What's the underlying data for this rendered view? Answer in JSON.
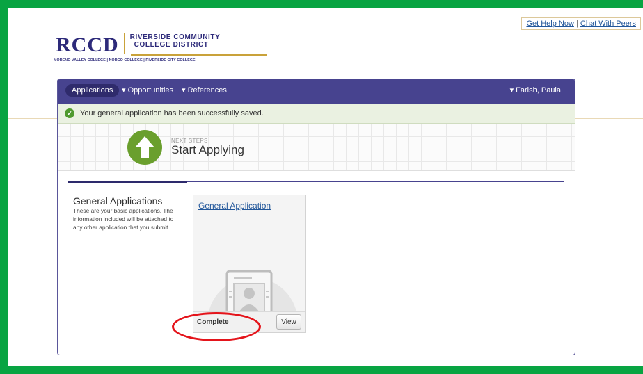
{
  "help": {
    "get_help": "Get Help Now",
    "separator": "|",
    "chat": "Chat With Peers"
  },
  "logo": {
    "acronym": "RCCD",
    "name_line1": "RIVERSIDE COMMUNITY",
    "name_line2": "COLLEGE DISTRICT",
    "colleges": "MORENO VALLEY COLLEGE | NORCO COLLEGE | RIVERSIDE CITY COLLEGE"
  },
  "nav": {
    "applications": "Applications",
    "opportunities": "▾ Opportunities",
    "references": "▾ References",
    "user": "▾ Farish, Paula"
  },
  "alert": {
    "icon": "check-circle-icon",
    "message": "Your general application has been successfully saved."
  },
  "banner": {
    "icon": "arrow-up-icon",
    "next_label": "NEXT STEPS",
    "title": "Start Applying"
  },
  "section": {
    "title": "General Applications",
    "description": "These are your basic applications. The information included will be attached to any other application that you submit."
  },
  "application_tile": {
    "link_label": "General Application",
    "icon": "id-document-icon",
    "status": "Complete",
    "view_label": "View"
  },
  "colors": {
    "screen_border": "#08a442",
    "navbar": "#47438f",
    "brand_navy": "#2d2a7a",
    "brand_gold": "#c9a23a",
    "success_green": "#4f9a2e",
    "link": "#21569a",
    "highlight": "#e4141b"
  }
}
